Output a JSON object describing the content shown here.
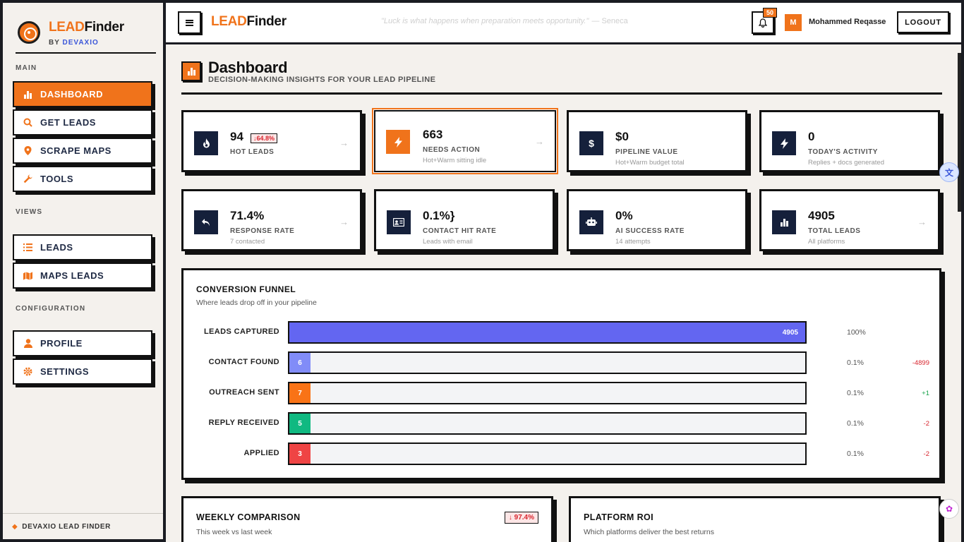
{
  "brand": {
    "lead": "LEAD",
    "finder": "Finder",
    "by": "BY",
    "by_company": "DEVAXIO"
  },
  "sidebar": {
    "sections": {
      "main": "MAIN",
      "views": "VIEWS",
      "configuration": "CONFIGURATION"
    },
    "items": [
      {
        "label": "DASHBOARD",
        "icon": "bar-chart-icon",
        "active": true
      },
      {
        "label": "GET LEADS",
        "icon": "search-icon"
      },
      {
        "label": "SCRAPE MAPS",
        "icon": "map-pin-icon"
      },
      {
        "label": "TOOLS",
        "icon": "wrench-icon"
      },
      {
        "label": "LEADS",
        "icon": "list-icon"
      },
      {
        "label": "MAPS LEADS",
        "icon": "map-icon"
      },
      {
        "label": "PROFILE",
        "icon": "user-icon"
      },
      {
        "label": "SETTINGS",
        "icon": "gear-icon"
      }
    ],
    "footer": "DEVAXIO LEAD FINDER"
  },
  "topbar": {
    "quote": "\"Luck is what happens when preparation meets opportunity.\"",
    "quote_author": "— Seneca",
    "notification_count": "50",
    "avatar_initial": "M",
    "username": "Mohammed Reqasse",
    "logout_label": "LOGOUT"
  },
  "page": {
    "title": "Dashboard",
    "subtitle": "DECISION-MAKING INSIGHTS FOR YOUR LEAD PIPELINE"
  },
  "stats": [
    {
      "value": "94",
      "label": "HOT LEADS",
      "sub": "",
      "delta": "↓64.8%",
      "icon": "fire-icon"
    },
    {
      "value": "663",
      "label": "NEEDS ACTION",
      "sub": "Hot+Warm sitting idle",
      "icon": "bolt-icon"
    },
    {
      "value": "$0",
      "label": "PIPELINE VALUE",
      "sub": "Hot+Warm budget total",
      "icon": "dollar-icon"
    },
    {
      "value": "0",
      "label": "TODAY'S ACTIVITY",
      "sub": "Replies + docs generated",
      "icon": "bolt-icon"
    },
    {
      "value": "71.4%",
      "label": "RESPONSE RATE",
      "sub": "7 contacted",
      "icon": "reply-icon"
    },
    {
      "value": "0.1%}",
      "label": "CONTACT HIT RATE",
      "sub": "Leads with email",
      "icon": "contact-card-icon"
    },
    {
      "value": "0%",
      "label": "AI SUCCESS RATE",
      "sub": "14 attempts",
      "icon": "robot-icon"
    },
    {
      "value": "4905",
      "label": "TOTAL LEADS",
      "sub": "All platforms",
      "icon": "bar-chart-icon"
    }
  ],
  "funnel": {
    "title": "CONVERSION FUNNEL",
    "subtitle": "Where leads drop off in your pipeline",
    "colors": {
      "leads": "#6366f1",
      "contact": "#818cf8",
      "outreach": "#f97316",
      "reply": "#10b981",
      "applied": "#ef4444"
    },
    "rows": [
      {
        "label": "LEADS CAPTURED",
        "value": "4905",
        "fraction": 1.0,
        "pct": "100%",
        "delta": ""
      },
      {
        "label": "CONTACT FOUND",
        "value": "6",
        "fraction": 0.001,
        "pct": "0.1%",
        "delta": "-4899"
      },
      {
        "label": "OUTREACH SENT",
        "value": "7",
        "fraction": 0.001,
        "pct": "0.1%",
        "delta": "+1"
      },
      {
        "label": "REPLY RECEIVED",
        "value": "5",
        "fraction": 0.001,
        "pct": "0.1%",
        "delta": "-2"
      },
      {
        "label": "APPLIED",
        "value": "3",
        "fraction": 0.001,
        "pct": "0.1%",
        "delta": "-2"
      }
    ]
  },
  "weekly": {
    "title": "WEEKLY COMPARISON",
    "subtitle": "This week vs last week",
    "delta": "↓ 97.4%"
  },
  "roi": {
    "title": "PLATFORM ROI",
    "subtitle": "Which platforms deliver the best returns"
  }
}
